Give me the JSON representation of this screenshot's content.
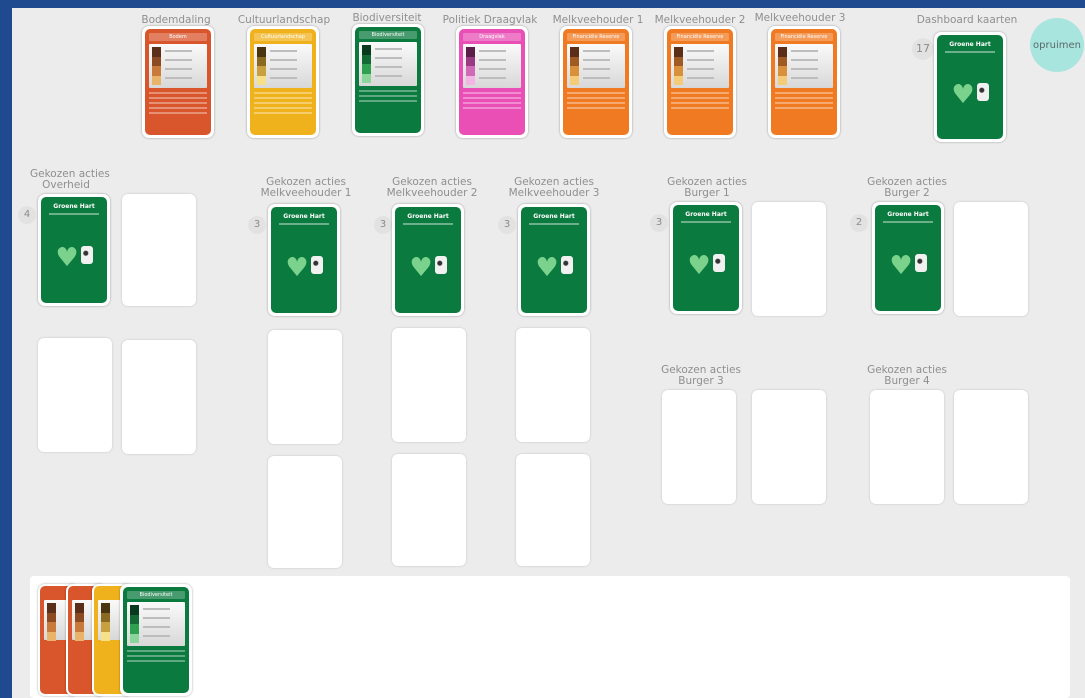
{
  "top_cards": [
    {
      "label": "Bodemdaling",
      "color": "#d9552b",
      "header": "Bodem"
    },
    {
      "label": "Cultuurlandschap",
      "color": "#f0b21c",
      "header": "Cultuurlandschap"
    },
    {
      "label": "Biodiversiteit",
      "color": "#0b7a3e",
      "header": "Biodiversiteit"
    },
    {
      "label": "Politiek Draagvlak",
      "color": "#e94fb5",
      "header": "Draagvlak"
    },
    {
      "label": "Melkveehouder 1",
      "color": "#f07a22",
      "header": "Financiële Reserve"
    },
    {
      "label": "Melkveehouder 2",
      "color": "#f07a22",
      "header": "Financiële Reserve"
    },
    {
      "label": "Melkveehouder 3",
      "color": "#f07a22",
      "header": "Financiële Reserve"
    }
  ],
  "dashboard": {
    "label": "Dashboard kaarten",
    "count": "17"
  },
  "cleanup_button": "opruimen",
  "action_card": {
    "title": "Groene Hart"
  },
  "sections": [
    {
      "label_line1": "Gekozen acties",
      "label_line2": "Overheid",
      "count": "4"
    },
    {
      "label_line1": "Gekozen acties",
      "label_line2": "Melkveehouder 1",
      "count": "3"
    },
    {
      "label_line1": "Gekozen acties",
      "label_line2": "Melkveehouder 2",
      "count": "3"
    },
    {
      "label_line1": "Gekozen acties",
      "label_line2": "Melkveehouder 3",
      "count": "3"
    },
    {
      "label_line1": "Gekozen acties",
      "label_line2": "Burger 1",
      "count": "3"
    },
    {
      "label_line1": "Gekozen acties",
      "label_line2": "Burger 2",
      "count": "2"
    },
    {
      "label_line1": "Gekozen acties",
      "label_line2": "Burger 3"
    },
    {
      "label_line1": "Gekozen acties",
      "label_line2": "Burger 4"
    }
  ],
  "hand": [
    {
      "color": "#d9552b"
    },
    {
      "color": "#d9552b"
    },
    {
      "color": "#f0b21c"
    },
    {
      "color": "#0b7a3e",
      "header": "Biodiversiteit"
    }
  ]
}
